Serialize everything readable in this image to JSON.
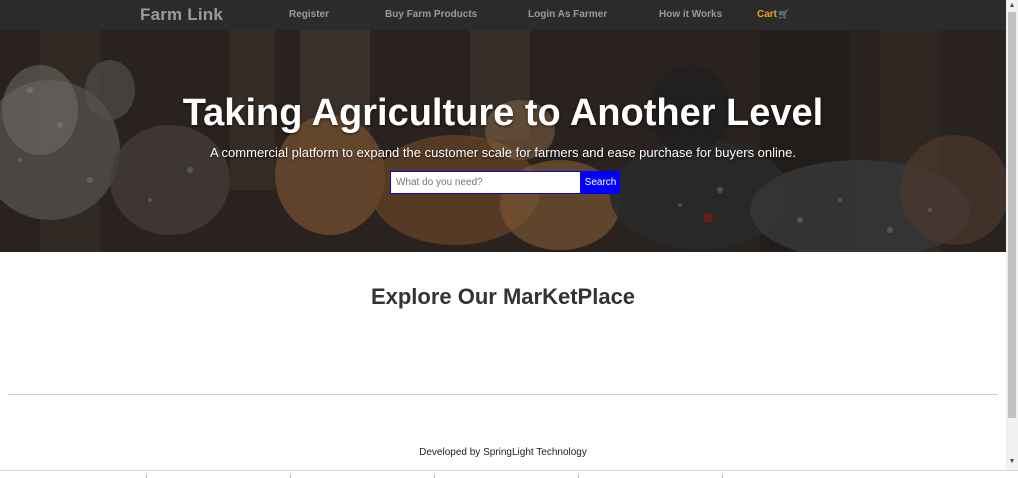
{
  "navbar": {
    "brand": "Farm Link",
    "links": [
      {
        "label": "Register"
      },
      {
        "label": "Buy Farm Products"
      },
      {
        "label": "Login As Farmer"
      },
      {
        "label": "How it Works"
      },
      {
        "label": "Cart"
      }
    ],
    "cart_icon": "cart-icon",
    "cart_color": "#f0a020"
  },
  "hero": {
    "title": "Taking Agriculture to Another Level",
    "subtitle": "A commercial platform to expand the customer scale for farmers and ease purchase for buyers online.",
    "search": {
      "placeholder": "What do you need?",
      "value": "",
      "button_label": "Search",
      "button_color": "#0000ff"
    }
  },
  "marketplace": {
    "title": "Explore Our MarKetPlace"
  },
  "footer": {
    "credit": "Developed by SpringLight Technology"
  }
}
